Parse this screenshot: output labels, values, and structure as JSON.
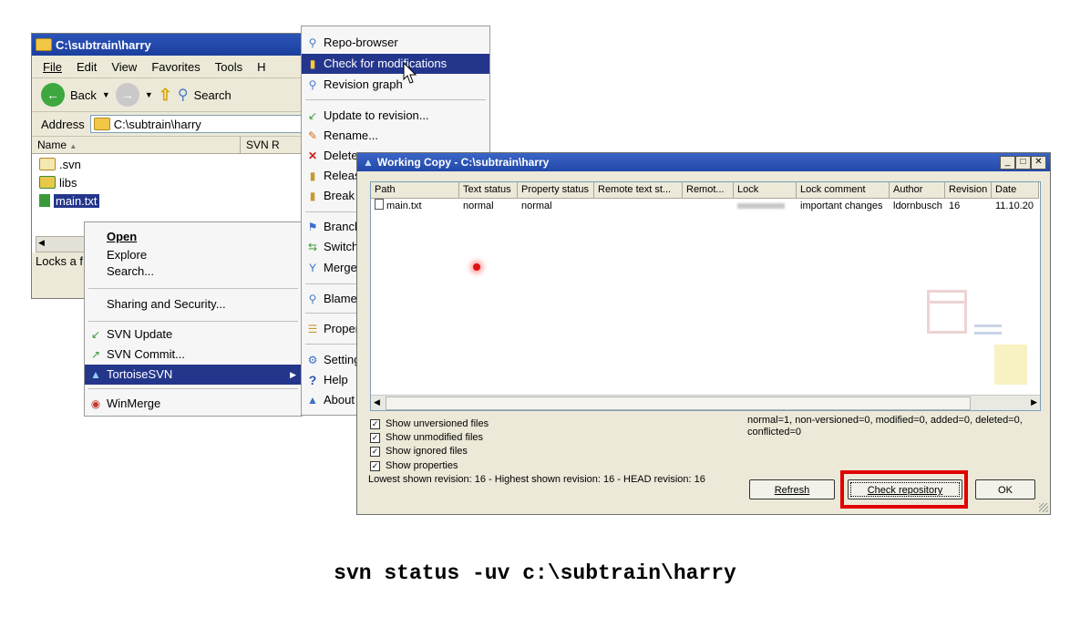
{
  "explorer": {
    "title": "C:\\subtrain\\harry",
    "menu": [
      "File",
      "Edit",
      "View",
      "Favorites",
      "Tools",
      "H"
    ],
    "toolbar": {
      "back": "Back",
      "search": "Search"
    },
    "address_label": "Address",
    "address_value": "C:\\subtrain\\harry",
    "columns": [
      "Name",
      "SVN R"
    ],
    "files": [
      ".svn",
      "libs",
      "main.txt"
    ],
    "status": "Locks a f"
  },
  "context_menu": {
    "items": [
      "Open",
      "Explore",
      "Search...",
      "Sharing and Security...",
      "SVN Update",
      "SVN Commit...",
      "TortoiseSVN",
      "WinMerge"
    ]
  },
  "tortoise_menu": {
    "items": [
      "Repo-browser",
      "Check for modifications",
      "Revision graph",
      "Update to revision...",
      "Rename...",
      "Delete",
      "Release",
      "Break",
      "Branch",
      "Switch",
      "Merge",
      "Blame",
      "Properties",
      "Settings",
      "Help",
      "About"
    ]
  },
  "dialog": {
    "title": "Working Copy - C:\\subtrain\\harry",
    "columns": [
      "Path",
      "Text status",
      "Property status",
      "Remote text st...",
      "Remot...",
      "Lock",
      "Lock comment",
      "Author",
      "Revision",
      "Date"
    ],
    "rows": [
      {
        "path": "main.txt",
        "text_status": "normal",
        "prop_status": "normal",
        "remote_text": "",
        "remote_prop": "",
        "lock": "",
        "lock_comment": "important changes",
        "author": "ldornbusch",
        "revision": "16",
        "date": "11.10.20"
      }
    ],
    "checkboxes": [
      "Show unversioned files",
      "Show unmodified files",
      "Show ignored files",
      "Show properties"
    ],
    "summary_line1": "normal=1, non-versioned=0, modified=0, added=0, deleted=0,",
    "summary_line2": "conflicted=0",
    "revision_info": "Lowest shown revision: 16 - Highest shown revision: 16 - HEAD revision: 16",
    "buttons": {
      "refresh": "Refresh",
      "check_repository": "Check repository",
      "ok": "OK"
    }
  },
  "caption": "svn status -uv c:\\subtrain\\harry",
  "colors": {
    "highlight": "#24368c",
    "title_blue": "#2248a8",
    "callout_red": "#e00000"
  }
}
